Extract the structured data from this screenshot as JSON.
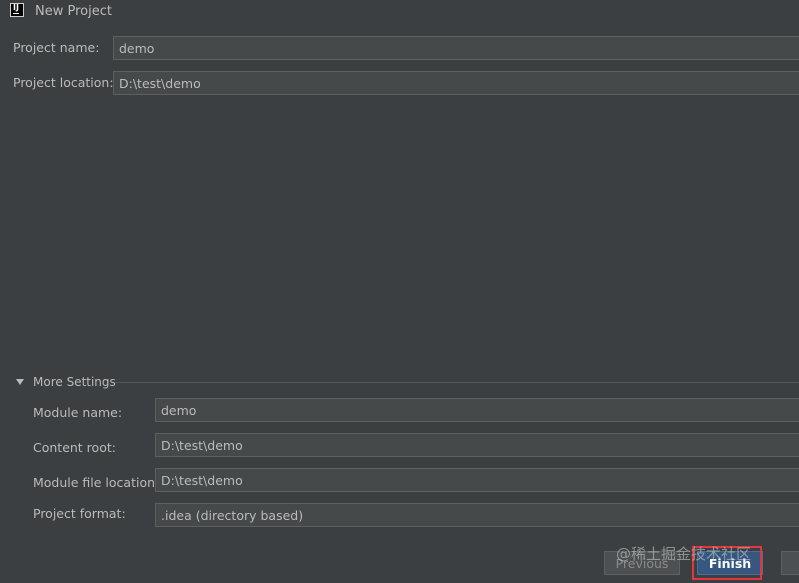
{
  "window": {
    "title": "New Project"
  },
  "project_name": {
    "label": "Project name:",
    "value": "demo"
  },
  "project_location": {
    "label": "Project location:",
    "value": "D:\\test\\demo"
  },
  "more_settings": {
    "title": "More Settings",
    "module_name": {
      "label": "Module name:",
      "value": "demo"
    },
    "content_root": {
      "label": "Content root:",
      "value": "D:\\test\\demo"
    },
    "module_file_location": {
      "label": "Module file location:",
      "value": "D:\\test\\demo"
    },
    "project_format": {
      "label": "Project format:",
      "value": ".idea (directory based)"
    }
  },
  "buttons": {
    "previous": "Previous",
    "finish": "Finish"
  },
  "watermark": "@稀土掘金技术社区"
}
